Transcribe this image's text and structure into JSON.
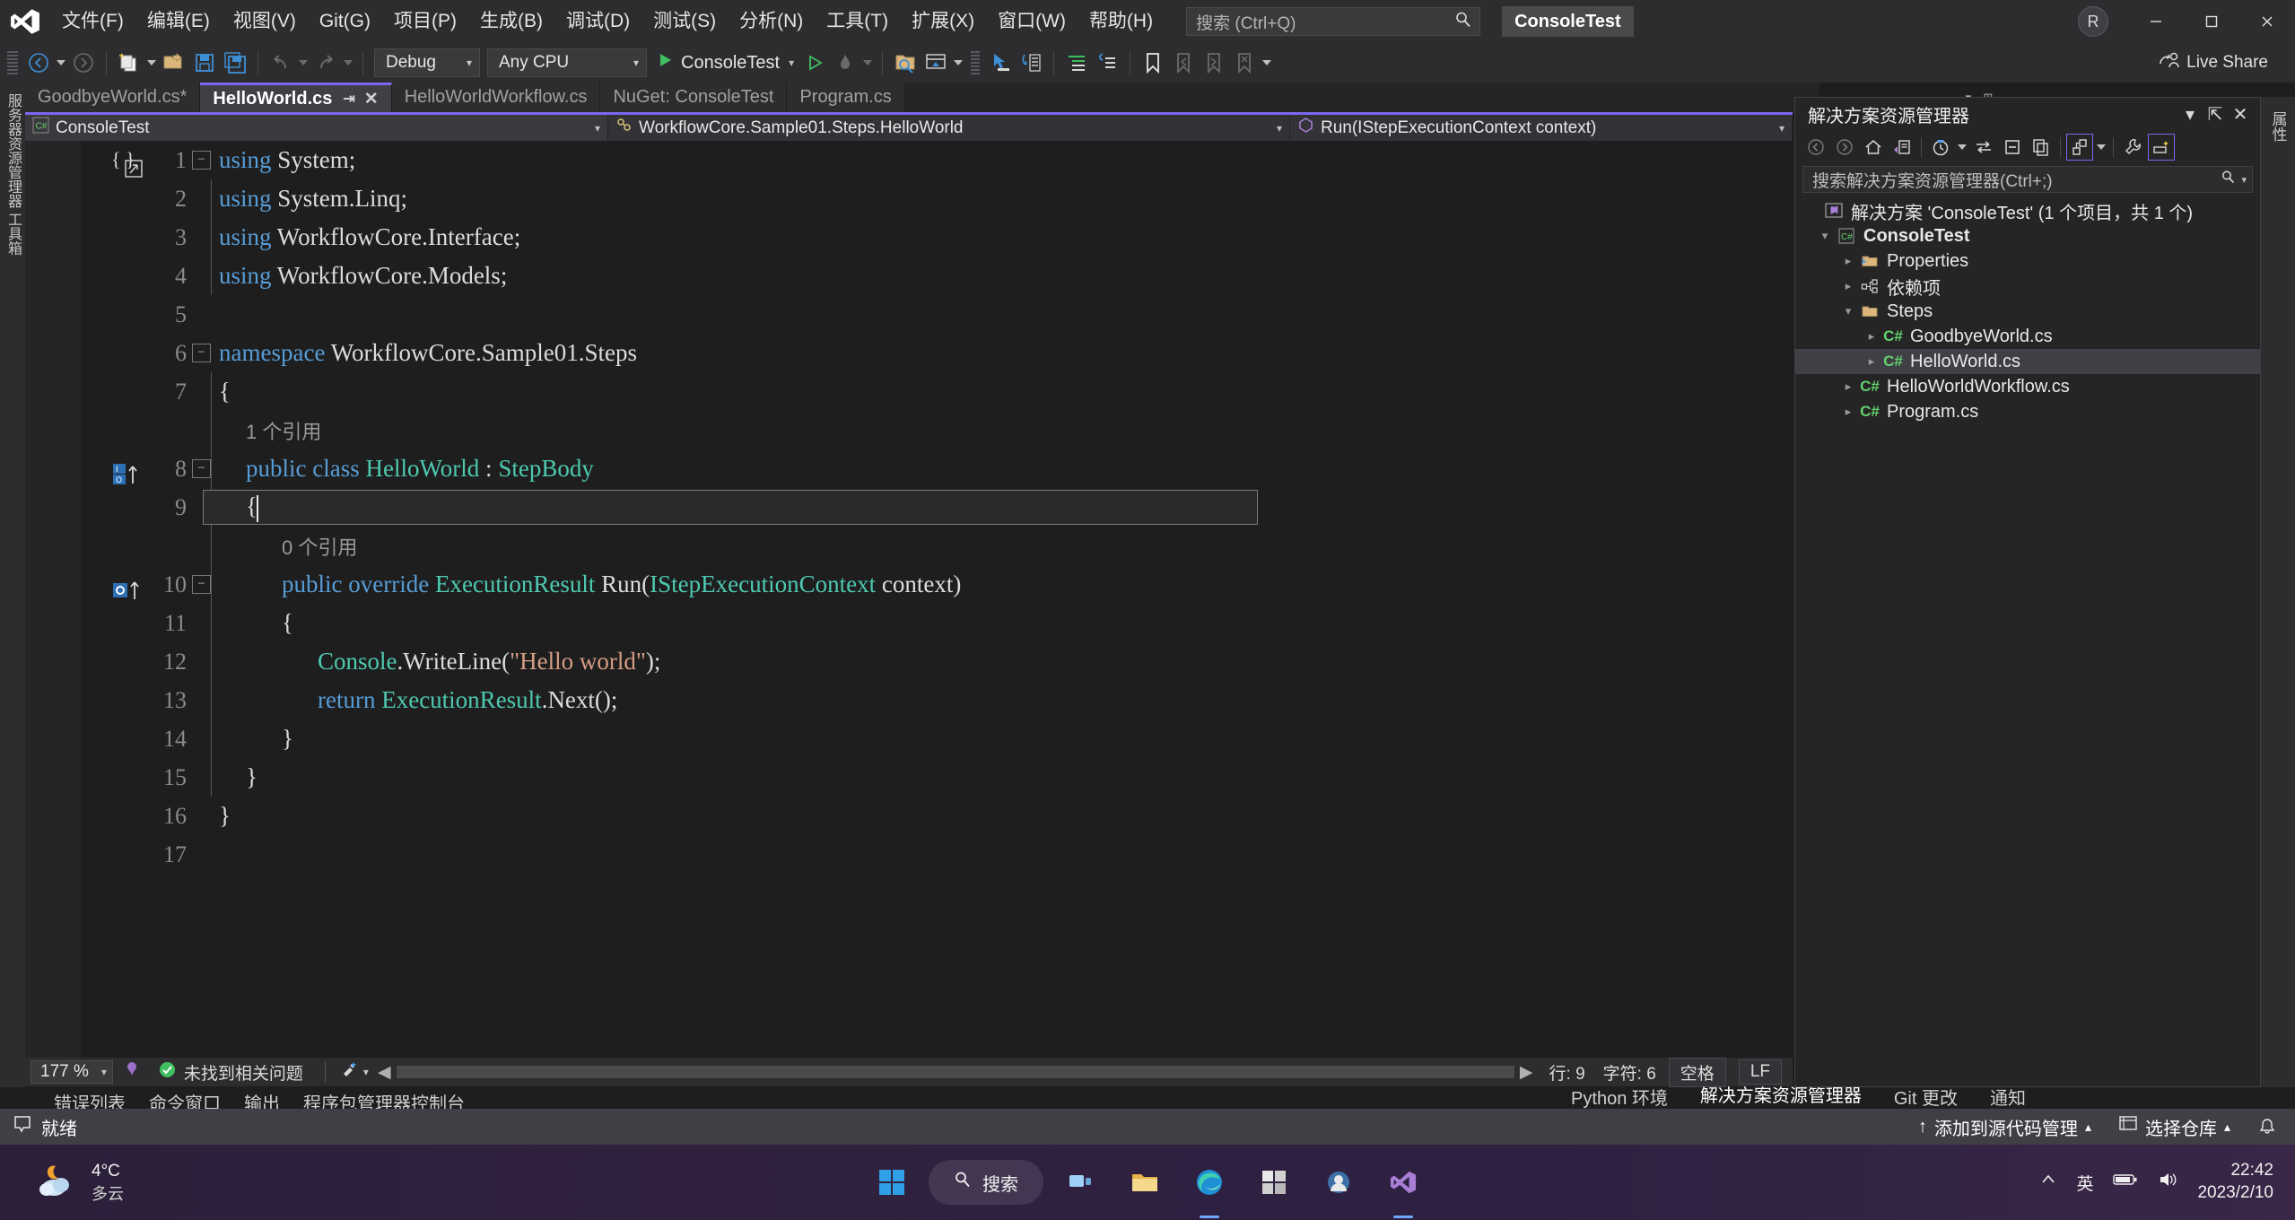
{
  "titlebar": {
    "logo_icon": "visual-studio-logo",
    "menus": [
      {
        "label": "文件(F)"
      },
      {
        "label": "编辑(E)"
      },
      {
        "label": "视图(V)"
      },
      {
        "label": "Git(G)"
      },
      {
        "label": "项目(P)"
      },
      {
        "label": "生成(B)"
      },
      {
        "label": "调试(D)"
      },
      {
        "label": "测试(S)"
      },
      {
        "label": "分析(N)"
      },
      {
        "label": "工具(T)"
      },
      {
        "label": "扩展(X)"
      },
      {
        "label": "窗口(W)"
      },
      {
        "label": "帮助(H)"
      }
    ],
    "search_placeholder": "搜索 (Ctrl+Q)",
    "search_icon": "search-icon",
    "project_pill": "ConsoleTest",
    "account_initial": "R",
    "window_minimize": "—",
    "window_maximize": "▢",
    "window_close": "✕"
  },
  "toolbar": {
    "nav_back_icon": "arrow-back-icon",
    "nav_forward_icon": "arrow-forward-icon",
    "new_project_icon": "new-project-icon",
    "open_file_icon": "open-file-icon",
    "save_icon": "save-icon",
    "save_all_icon": "save-all-icon",
    "undo_icon": "undo-icon",
    "redo_icon": "redo-icon",
    "config_value": "Debug",
    "platform_value": "Any CPU",
    "start_label": "ConsoleTest",
    "start_icon": "play-icon",
    "start_no_debug_icon": "play-outline-icon",
    "hot_reload_icon": "hot-reload-icon",
    "find_in_files_icon": "find-in-files-icon",
    "window_layout_icon": "window-layout-icon",
    "select_tool_icon": "pointer-icon",
    "step_icon": "step-into-icon",
    "comment_icon": "comment-lines-icon",
    "uncomment_icon": "uncomment-lines-icon",
    "bookmark_icon": "bookmark-icon",
    "bookmark_prev_icon": "bookmark-prev-icon",
    "bookmark_next_icon": "bookmark-next-icon",
    "bookmark_clear_icon": "bookmark-clear-icon",
    "live_share_label": "Live Share",
    "live_share_icon": "live-share-icon"
  },
  "tabs": [
    {
      "label": "GoodbyeWorld.cs*",
      "active": false
    },
    {
      "label": "HelloWorld.cs",
      "active": true,
      "pin_icon": "pin-icon",
      "close_icon": "close-icon"
    },
    {
      "label": "HelloWorldWorkflow.cs",
      "active": false
    },
    {
      "label": "NuGet: ConsoleTest",
      "active": false
    },
    {
      "label": "Program.cs",
      "active": false
    }
  ],
  "breadcrumb": {
    "project_icon": "csharp-project-icon",
    "project": "ConsoleTest",
    "type_icon": "class-icon",
    "type": "WorkflowCore.Sample01.Steps.HelloWorld",
    "member_icon": "method-icon",
    "member": "Run(IStepExecutionContext context)",
    "dropdown_icon": "chevron-down-icon"
  },
  "editor": {
    "collapse_all_icon": "collapse-all-icon",
    "lines": [
      {
        "num": "1",
        "fold": "−",
        "segments": [
          {
            "t": "using ",
            "c": "k"
          },
          {
            "t": "System;",
            "c": "p"
          }
        ]
      },
      {
        "num": "2",
        "fold": "",
        "segments": [
          {
            "t": "using ",
            "c": "k"
          },
          {
            "t": "System.Linq;",
            "c": "p"
          }
        ]
      },
      {
        "num": "3",
        "fold": "",
        "segments": [
          {
            "t": "using ",
            "c": "k"
          },
          {
            "t": "WorkflowCore.Interface;",
            "c": "p"
          }
        ]
      },
      {
        "num": "4",
        "fold": "",
        "segments": [
          {
            "t": "using ",
            "c": "k"
          },
          {
            "t": "WorkflowCore.Models;",
            "c": "p"
          }
        ]
      },
      {
        "num": "5",
        "fold": "",
        "segments": []
      },
      {
        "num": "6",
        "fold": "−",
        "segments": [
          {
            "t": "namespace ",
            "c": "k"
          },
          {
            "t": "WorkflowCore.Sample01.Steps",
            "c": "p"
          }
        ]
      },
      {
        "num": "7",
        "fold": "",
        "segments": [
          {
            "t": "{",
            "c": "p"
          }
        ]
      },
      {
        "num": "8",
        "fold": "−",
        "segments": [
          {
            "t": "    public class ",
            "c": "k"
          },
          {
            "t": "HelloWorld",
            "c": "t"
          },
          {
            "t": " : ",
            "c": "p"
          },
          {
            "t": "StepBody",
            "c": "t"
          }
        ]
      },
      {
        "num": "9",
        "fold": "",
        "segments": [
          {
            "t": "    {",
            "c": "p"
          }
        ]
      },
      {
        "num": "10",
        "fold": "−",
        "segments": [
          {
            "t": "        public override ",
            "c": "k"
          },
          {
            "t": "ExecutionResult",
            "c": "t"
          },
          {
            "t": " Run(",
            "c": "p"
          },
          {
            "t": "IStepExecutionContext",
            "c": "t"
          },
          {
            "t": " context)",
            "c": "p"
          }
        ]
      },
      {
        "num": "11",
        "fold": "",
        "segments": [
          {
            "t": "        {",
            "c": "p"
          }
        ]
      },
      {
        "num": "12",
        "fold": "",
        "segments": [
          {
            "t": "            ",
            "c": "p"
          },
          {
            "t": "Console",
            "c": "t"
          },
          {
            "t": ".WriteLine(",
            "c": "p"
          },
          {
            "t": "\"Hello world\"",
            "c": "s"
          },
          {
            "t": ");",
            "c": "p"
          }
        ]
      },
      {
        "num": "13",
        "fold": "",
        "segments": [
          {
            "t": "            ",
            "c": "p"
          },
          {
            "t": "return ",
            "c": "k"
          },
          {
            "t": "ExecutionResult",
            "c": "t"
          },
          {
            "t": ".Next();",
            "c": "p"
          }
        ]
      },
      {
        "num": "14",
        "fold": "",
        "segments": [
          {
            "t": "        }",
            "c": "p"
          }
        ]
      },
      {
        "num": "15",
        "fold": "",
        "segments": [
          {
            "t": "    }",
            "c": "p"
          }
        ]
      },
      {
        "num": "16",
        "fold": "",
        "segments": [
          {
            "t": "}",
            "c": "p"
          }
        ]
      },
      {
        "num": "17",
        "fold": "",
        "segments": []
      }
    ],
    "codelens_class": "1 个引用",
    "codelens_method": "0 个引用",
    "glyph_class_icon": "class-inheritance-glyph",
    "glyph_method_icon": "method-override-glyph"
  },
  "editor_status": {
    "zoom": "177 %",
    "zoom_caret": "▾",
    "pen_icon": "ink-annotation-icon",
    "health_icon": "check-circle-icon",
    "health_text": "未找到相关问题",
    "broom_icon": "code-cleanup-icon",
    "line_label": "行: 9",
    "char_label": "字符: 6",
    "spaces_label": "空格",
    "eol_label": "LF",
    "scroll_left_icon": "scroll-left-icon",
    "scroll_right_icon": "scroll-right-icon"
  },
  "dock_tabs": [
    {
      "label": "错误列表"
    },
    {
      "label": "命令窗口"
    },
    {
      "label": "输出"
    },
    {
      "label": "程序包管理器控制台"
    }
  ],
  "dock_right_tabs": [
    {
      "label": "Python 环境"
    },
    {
      "label": "解决方案资源管理器",
      "active": true
    },
    {
      "label": "Git 更改"
    },
    {
      "label": "通知"
    }
  ],
  "solution_explorer": {
    "title": "解决方案资源管理器",
    "dropdown_icon": "chevron-down-icon",
    "pin_icon": "pin-icon",
    "close_icon": "close-icon",
    "toolbar_icons": [
      {
        "name": "back-icon",
        "glyph": "←",
        "selected": false
      },
      {
        "name": "forward-icon",
        "glyph": "→",
        "selected": false
      },
      {
        "name": "home-icon",
        "glyph": "⌂",
        "selected": false
      },
      {
        "name": "pending-changes-icon",
        "glyph": "▤",
        "selected": false
      },
      {
        "name": "history-icon",
        "glyph": "◷",
        "selected": false
      },
      {
        "name": "sync-icon",
        "glyph": "⇆",
        "selected": false
      },
      {
        "name": "collapse-all-icon",
        "glyph": "⊟",
        "selected": false
      },
      {
        "name": "show-all-files-icon",
        "glyph": "❐",
        "selected": false
      },
      {
        "name": "solution-view-icon",
        "glyph": "⁂",
        "selected": true
      },
      {
        "name": "properties-icon",
        "glyph": "🔧",
        "selected": false
      },
      {
        "name": "preview-selected-icon",
        "glyph": "▭",
        "selected": true
      }
    ],
    "search_placeholder": "搜索解决方案资源管理器(Ctrl+;)",
    "search_icon": "search-icon",
    "search_dropdown_icon": "chevron-down-icon",
    "tree": [
      {
        "label": "解决方案 'ConsoleTest' (1 个项目，共 1 个)",
        "indent": 0,
        "twisty": "",
        "icon": "solution-icon",
        "bold": false,
        "selected": false
      },
      {
        "label": "ConsoleTest",
        "indent": 1,
        "twisty": "▾",
        "icon": "csharp-project-icon",
        "bold": true,
        "selected": false
      },
      {
        "label": "Properties",
        "indent": 2,
        "twisty": "▸",
        "icon": "properties-folder-icon",
        "bold": false,
        "selected": false
      },
      {
        "label": "依赖项",
        "indent": 2,
        "twisty": "▸",
        "icon": "dependencies-icon",
        "bold": false,
        "selected": false
      },
      {
        "label": "Steps",
        "indent": 2,
        "twisty": "▾",
        "icon": "folder-icon",
        "bold": false,
        "selected": false
      },
      {
        "label": "GoodbyeWorld.cs",
        "indent": 3,
        "twisty": "▸",
        "icon": "csharp-file-icon",
        "bold": false,
        "selected": false
      },
      {
        "label": "HelloWorld.cs",
        "indent": 3,
        "twisty": "▸",
        "icon": "csharp-file-icon",
        "bold": false,
        "selected": true
      },
      {
        "label": "HelloWorldWorkflow.cs",
        "indent": 2,
        "twisty": "▸",
        "icon": "csharp-file-icon",
        "bold": false,
        "selected": false
      },
      {
        "label": "Program.cs",
        "indent": 2,
        "twisty": "▸",
        "icon": "csharp-file-icon",
        "bold": false,
        "selected": false
      }
    ]
  },
  "left_rail": "服务器资源管理器   工具箱",
  "right_rail": "属性",
  "vs_status": {
    "ready_icon": "ready-flag-icon",
    "ready_text": "就绪",
    "add_source_control_icon": "arrow-up-icon",
    "add_source_control": "添加到源代码管理",
    "add_source_control_caret": "▴",
    "select_repo_icon": "repository-icon",
    "select_repo": "选择仓库",
    "select_repo_caret": "▴",
    "bell_icon": "bell-icon"
  },
  "taskbar": {
    "weather_icon": "night-cloudy-icon",
    "weather_temp": "4°C",
    "weather_desc": "多云",
    "start_icon": "windows-start-icon",
    "search_icon": "search-icon",
    "search_label": "搜索",
    "taskview_icon": "task-view-icon",
    "explorer_icon": "file-explorer-icon",
    "edge_icon": "microsoft-edge-icon",
    "store_icon": "microsoft-store-icon",
    "app_icon": "app-icon",
    "vs_icon": "visual-studio-icon",
    "chevron_up_icon": "chevron-up-icon",
    "ime_label": "英",
    "battery_icon": "battery-icon",
    "volume_icon": "volume-icon",
    "time": "22:42",
    "date": "2023/2/10"
  },
  "colors": {
    "accent_purple": "#7b68ee",
    "keyword_blue": "#569cd6",
    "type_teal": "#4ec9b0",
    "string_orange": "#d69d85",
    "status_bar": "#3f3f46",
    "editor_bg": "#1e1e1e"
  }
}
